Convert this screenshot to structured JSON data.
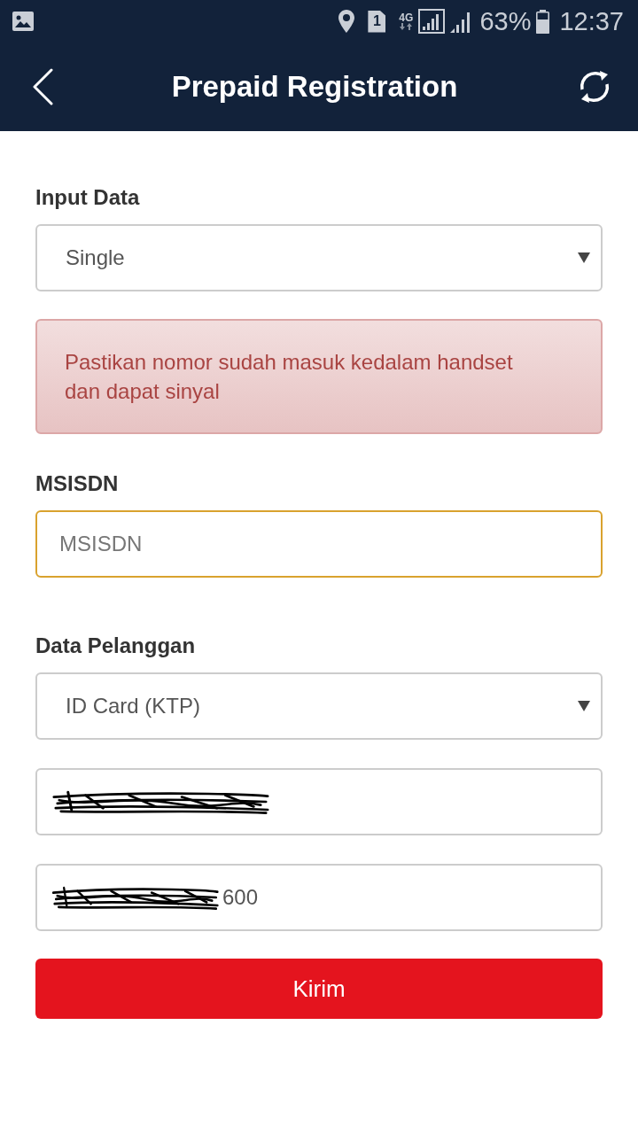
{
  "status_bar": {
    "sim_slot": "1",
    "network_type": "4G",
    "battery": "63%",
    "time": "12:37"
  },
  "header": {
    "title": "Prepaid Registration"
  },
  "form": {
    "items": [
      {
        "kind": "label",
        "text": "Input Data"
      },
      {
        "kind": "select",
        "value": "Single"
      },
      {
        "kind": "alert",
        "text": "Pastikan nomor sudah masuk kedalam handset dan dapat sinyal"
      },
      {
        "kind": "label",
        "text": "MSISDN"
      },
      {
        "kind": "input",
        "placeholder": "MSISDN",
        "focused": true,
        "redacted": false
      },
      {
        "kind": "label",
        "text": "Data Pelanggan"
      },
      {
        "kind": "select",
        "value": "ID Card (KTP)"
      },
      {
        "kind": "input",
        "focused": false,
        "redacted": true
      },
      {
        "kind": "input",
        "value": "600",
        "focused": false,
        "redacted": true
      },
      {
        "kind": "button",
        "text": "Kirim"
      }
    ]
  }
}
